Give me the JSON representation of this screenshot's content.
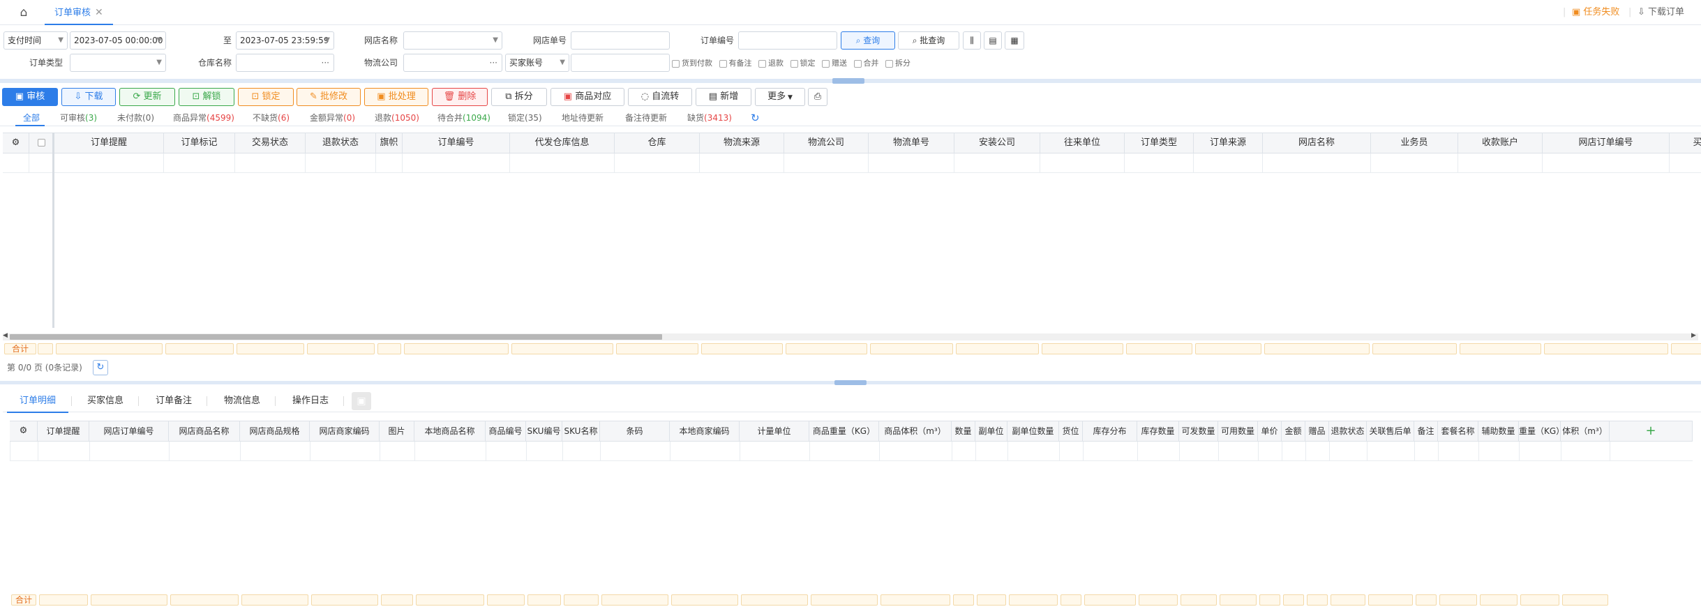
{
  "tabbar": {
    "home_icon": "home-icon",
    "active_tab": "订单审核",
    "close_icon": "close-icon",
    "task_fail": "任务失败",
    "download_order": "下载订单"
  },
  "filters": {
    "time_type": "支付时间",
    "start_time": "2023-07-05 00:00:00",
    "to_label": "至",
    "end_time": "2023-07-05 23:59:59",
    "shop_name_label": "网店名称",
    "shop_order_label": "网店单号",
    "order_no_label": "订单编号",
    "query_button": "查询",
    "batch_query_button": "批查询",
    "order_type_label": "订单类型",
    "warehouse_label": "仓库名称",
    "logistics_label": "物流公司",
    "buyer_account": "买家账号",
    "checkboxes": [
      "货到付款",
      "有备注",
      "退款",
      "锁定",
      "赠送",
      "合并",
      "拆分"
    ]
  },
  "actions": {
    "audit": "审核",
    "download": "下载",
    "update": "更新",
    "unlock": "解锁",
    "lock": "锁定",
    "batch_edit": "批修改",
    "batch_process": "批处理",
    "delete": "删除",
    "split": "拆分",
    "goods_match": "商品对应",
    "auto_flow": "自流转",
    "add": "新增",
    "more": "更多"
  },
  "status_tabs": [
    {
      "label": "全部",
      "count": ""
    },
    {
      "label": "可审核",
      "count": "(3)"
    },
    {
      "label": "未付款",
      "count": "(0)"
    },
    {
      "label": "商品异常",
      "count": "(4599)"
    },
    {
      "label": "不缺货",
      "count": "(6)"
    },
    {
      "label": "金额异常",
      "count": "(0)"
    },
    {
      "label": "退款",
      "count": "(1050)"
    },
    {
      "label": "待合并",
      "count": "(1094)"
    },
    {
      "label": "锁定",
      "count": "(35)"
    },
    {
      "label": "地址待更新",
      "count": ""
    },
    {
      "label": "备注待更新",
      "count": ""
    },
    {
      "label": "缺货",
      "count": "(3413)"
    }
  ],
  "order_columns": [
    "订单提醒",
    "订单标记",
    "交易状态",
    "退款状态",
    "旗帜",
    "订单编号",
    "代发仓库信息",
    "仓库",
    "物流来源",
    "物流公司",
    "物流单号",
    "安装公司",
    "往来单位",
    "订单类型",
    "订单来源",
    "网店名称",
    "业务员",
    "收款账户",
    "网店订单编号",
    "买家留言"
  ],
  "sum_label": "合计",
  "pagination": "第 0/0 页 (0条记录)",
  "bottom_tabs": [
    "订单明细",
    "买家信息",
    "订单备注",
    "物流信息",
    "操作日志"
  ],
  "detail_columns": [
    "订单提醒",
    "网店订单编号",
    "网店商品名称",
    "网店商品规格",
    "网店商家编码",
    "图片",
    "本地商品名称",
    "商品编号",
    "SKU编号",
    "SKU名称",
    "条码",
    "本地商家编码",
    "计量单位",
    "商品重量（KG）",
    "商品体积（m³）",
    "数量",
    "副单位",
    "副单位数量",
    "货位",
    "库存分布",
    "库存数量",
    "可发数量",
    "可用数量",
    "单价",
    "金额",
    "赠品",
    "退款状态",
    "关联售后单",
    "备注",
    "套餐名称",
    "辅助数量",
    "重量（KG）",
    "体积（m³）"
  ],
  "colors": {
    "accent": "#2d7de8",
    "orange": "#f08c1f",
    "red": "#e64545",
    "green": "#3aa84a"
  }
}
